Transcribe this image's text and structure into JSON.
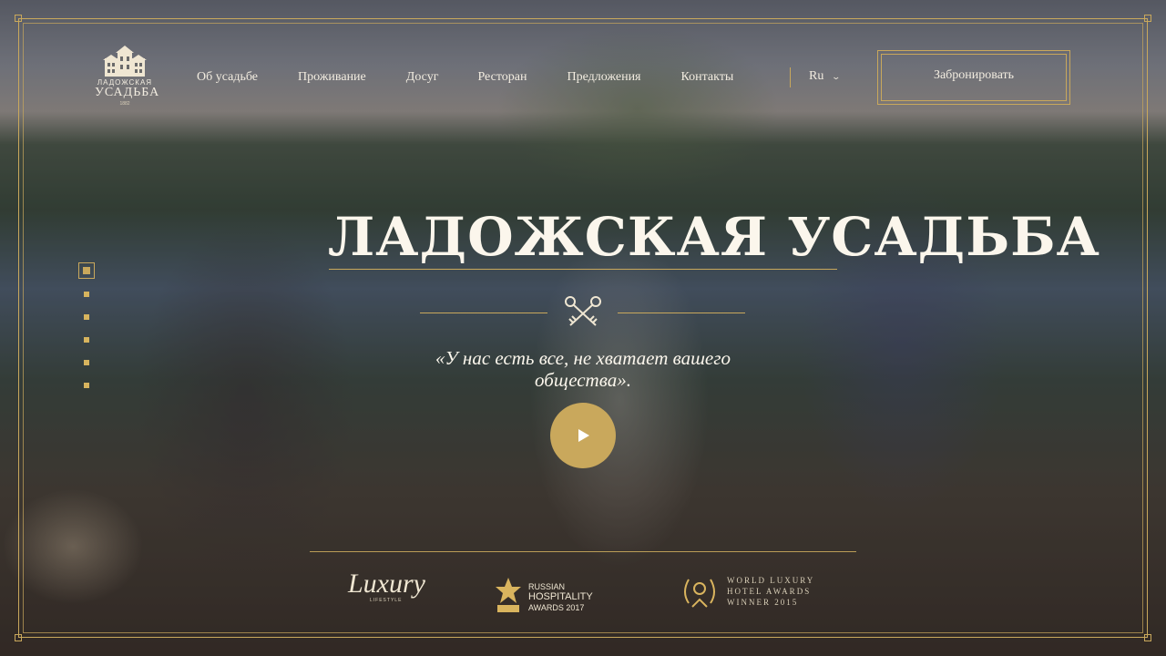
{
  "logo": {
    "line1": "ЛАДОЖСКАЯ",
    "line2": "УСАДЬБА",
    "line3": "1882"
  },
  "nav": {
    "items": [
      {
        "label": "Об усадьбе"
      },
      {
        "label": "Проживание"
      },
      {
        "label": "Досуг"
      },
      {
        "label": "Ресторан"
      },
      {
        "label": "Предложения"
      },
      {
        "label": "Контакты"
      }
    ],
    "language": "Ru"
  },
  "header": {
    "book_label": "Забронировать"
  },
  "hero": {
    "title": "Ладожская усадьба",
    "quote_line1": "«У нас есть все, не хватает вашего",
    "quote_line2": "общества»."
  },
  "slider": {
    "total": 6,
    "active": 1
  },
  "awards": [
    {
      "line1": "Luxury",
      "line2": "LIFESTYLE"
    },
    {
      "line1": "RUSSIAN",
      "line2": "HOSPITALITY",
      "line3": "AWARDS 2017"
    },
    {
      "line1": "WORLD LUXURY",
      "line2": "HOTEL AWARDS",
      "line3": "WINNER 2015"
    }
  ],
  "colors": {
    "accent": "#c9a85c",
    "text": "#f2ece0"
  }
}
